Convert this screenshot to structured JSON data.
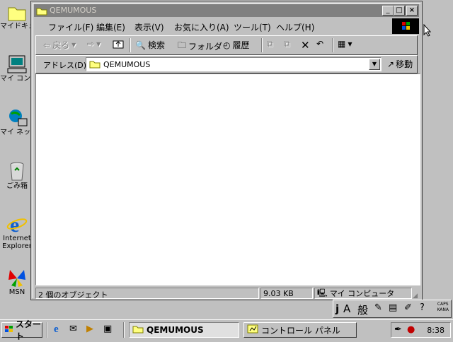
{
  "desktop": {
    "icons": [
      {
        "label": "マイドキュメント",
        "icon": "my-documents-icon"
      },
      {
        "label": "マイ コンピュータ",
        "icon": "my-computer-icon"
      },
      {
        "label": "マイ ネットワーク",
        "icon": "network-icon"
      },
      {
        "label": "ごみ箱",
        "icon": "recycle-bin-icon"
      },
      {
        "label": "Internet Explorer",
        "icon": "ie-icon"
      },
      {
        "label": "MSN",
        "icon": "msn-icon"
      }
    ]
  },
  "window": {
    "title": "QEMUMOUS",
    "caption_buttons": {
      "minimize": "_",
      "maximize": "□",
      "close": "×"
    },
    "menu": [
      "ファイル(F)",
      "編集(E)",
      "表示(V)",
      "お気に入り(A)",
      "ツール(T)",
      "ヘルプ(H)"
    ],
    "toolbar": {
      "back": "戻る",
      "search": "検索",
      "folders": "フォルダ",
      "history": "履歴"
    },
    "address": {
      "label": "アドレス(D)",
      "value": "QEMUMOUS",
      "go": "移動"
    },
    "status": {
      "objects": "2 個のオブジェクト",
      "size": "9.03 KB",
      "location": "マイ コンピュータ"
    }
  },
  "taskbar": {
    "start": "スタート",
    "tasks": [
      {
        "label": "QEMUMOUS",
        "active": true
      },
      {
        "label": "コントロール パネル",
        "active": false
      }
    ],
    "clock": "8:38"
  },
  "ime": {
    "mode": "A",
    "kanji": "般",
    "caps": "CAPS",
    "kana": "KANA"
  },
  "colors": {
    "face": "#c0c0c0",
    "title_inactive": "#808080",
    "content_bg": "#ffffff",
    "folder_yellow": "#ffff80"
  }
}
